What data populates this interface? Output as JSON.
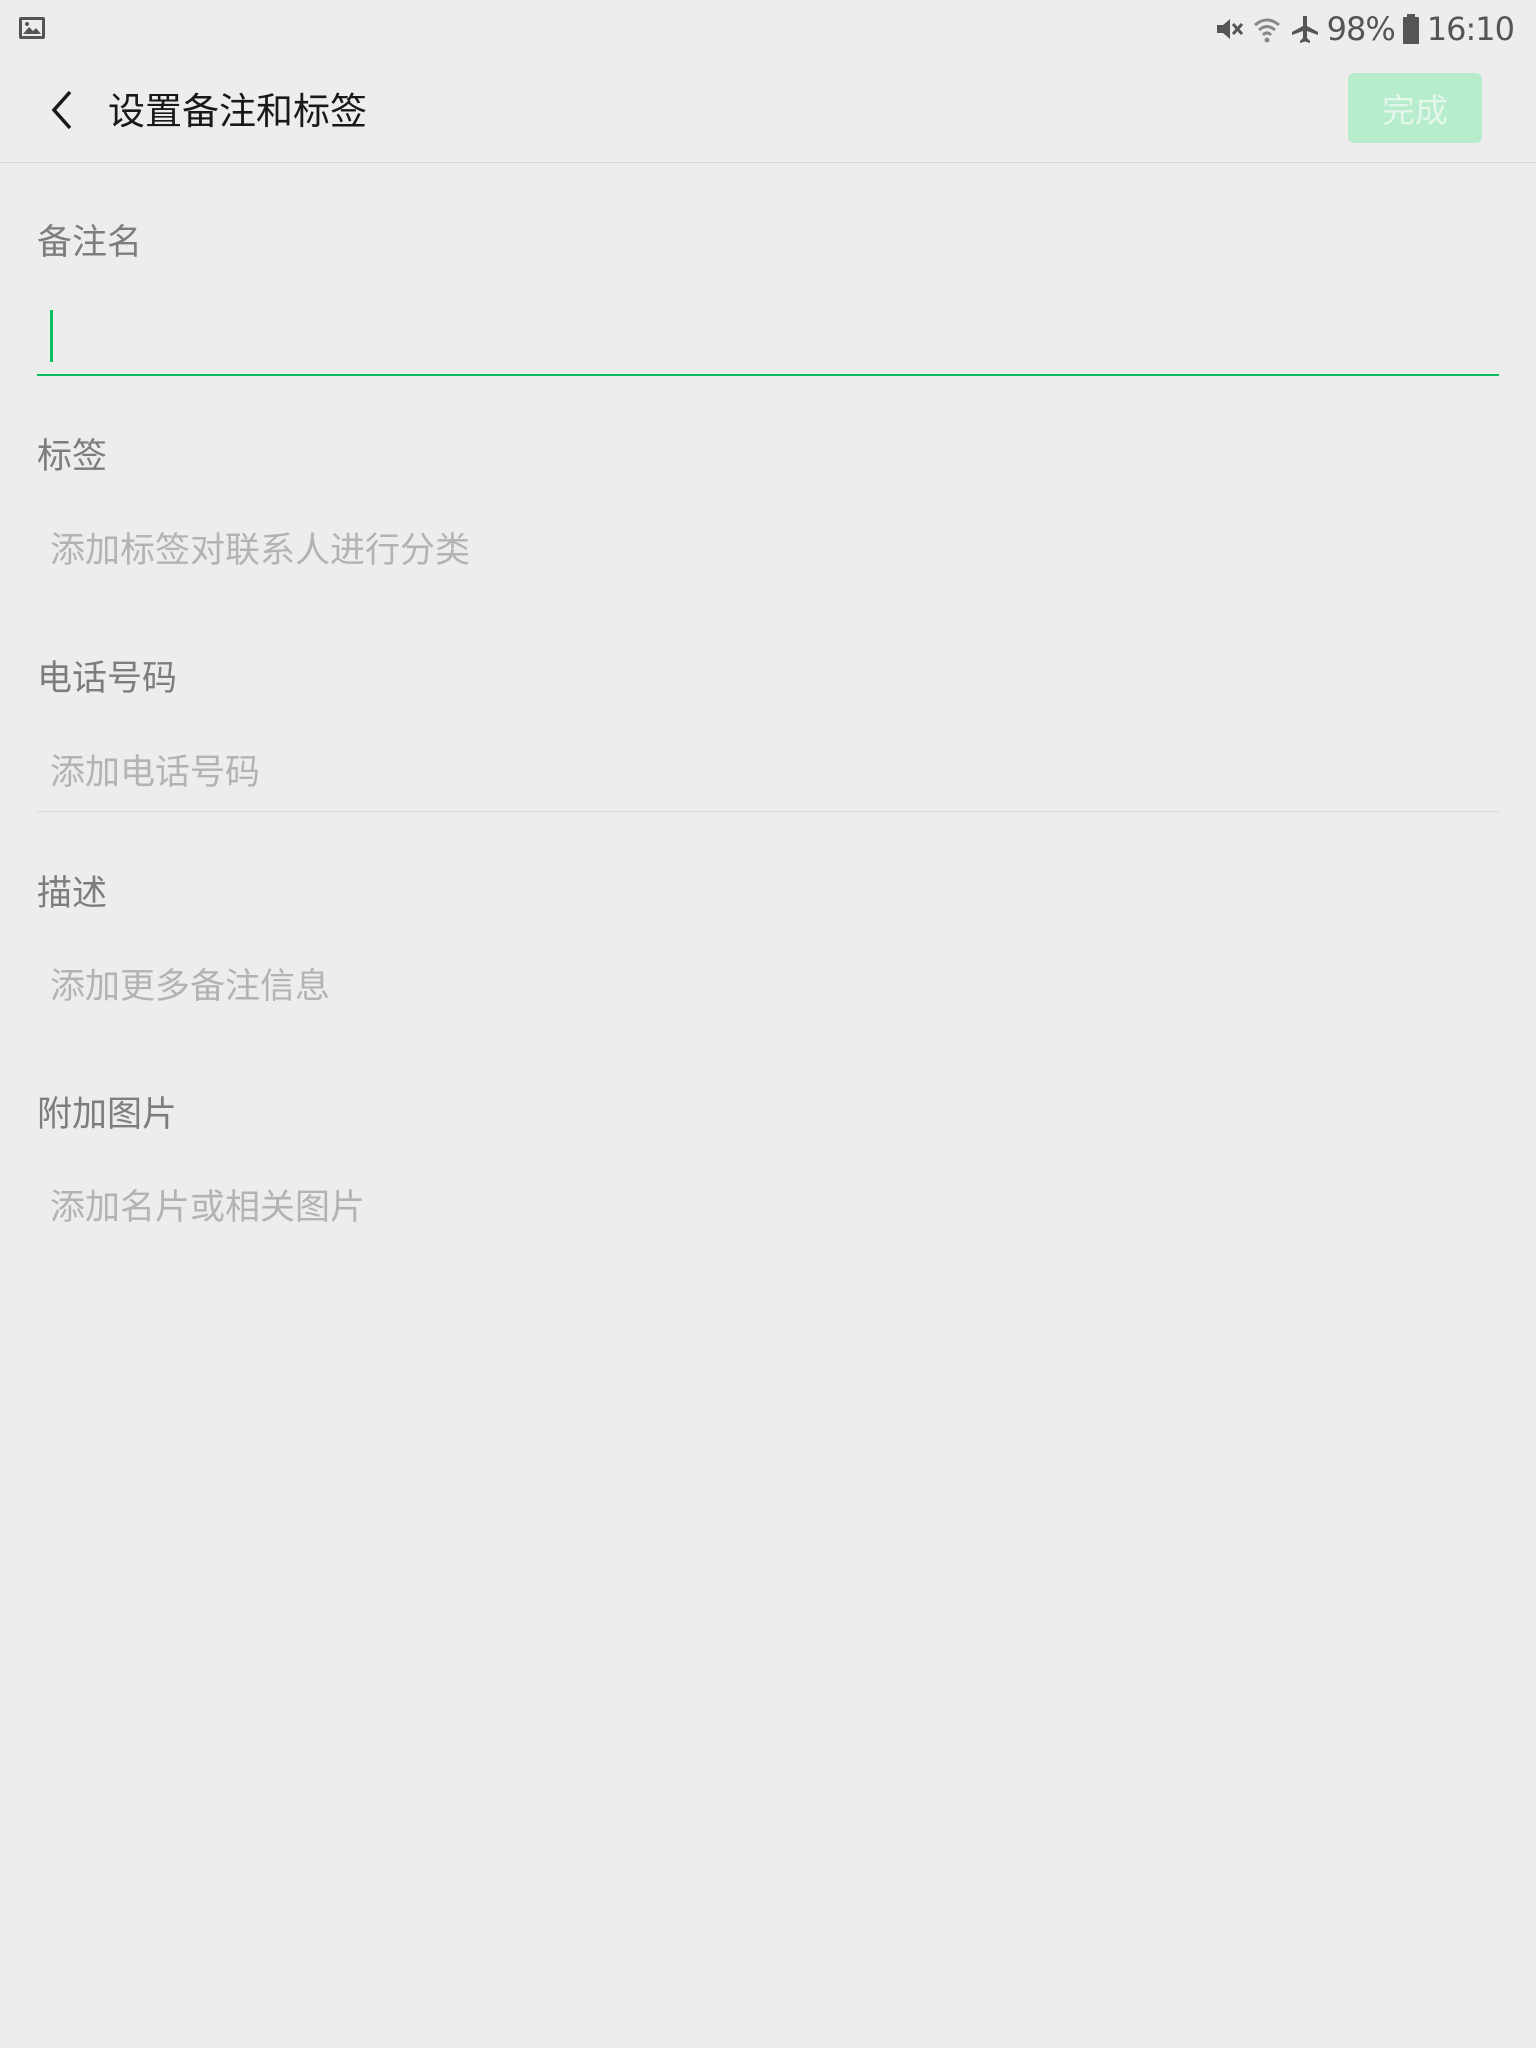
{
  "status_bar": {
    "left_icon": "image-icon",
    "icons": [
      "mute-icon",
      "wifi-icon",
      "airplane-icon"
    ],
    "battery_percent": "98%",
    "time": "16:10"
  },
  "header": {
    "back_icon": "chevron-left-icon",
    "title": "设置备注和标签",
    "done_label": "完成"
  },
  "form": {
    "remark": {
      "label": "备注名",
      "value": ""
    },
    "tags": {
      "label": "标签",
      "placeholder": "添加标签对联系人进行分类"
    },
    "phone": {
      "label": "电话号码",
      "placeholder": "添加电话号码"
    },
    "description": {
      "label": "描述",
      "placeholder": "添加更多备注信息"
    },
    "image": {
      "label": "附加图片",
      "placeholder": "添加名片或相关图片"
    }
  },
  "colors": {
    "accent": "#07c160",
    "done_button_bg": "#b7eccc",
    "background": "#ededed"
  }
}
